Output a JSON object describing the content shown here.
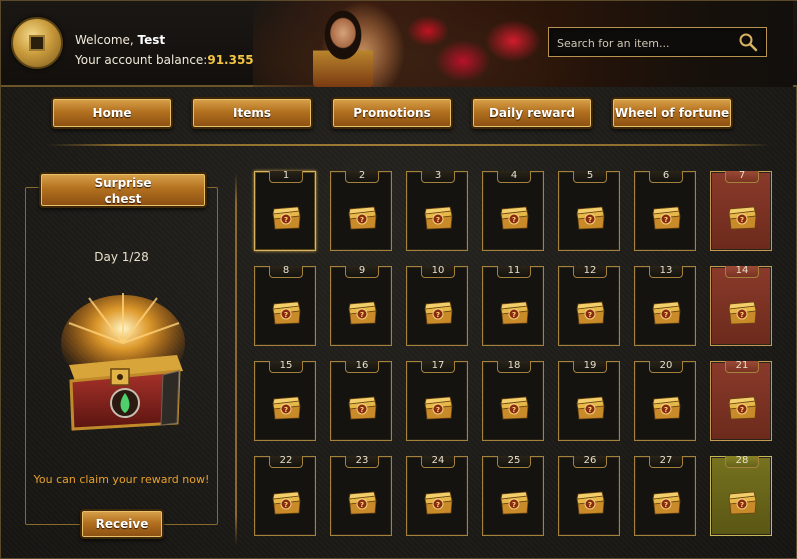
{
  "header": {
    "welcome_prefix": "Welcome, ",
    "username": "Test",
    "balance_label": "Your account balance:",
    "balance_value": "91.355"
  },
  "search": {
    "placeholder": "Search for an item...",
    "icon": "magnifier-icon"
  },
  "nav": {
    "items": [
      {
        "label": "Home"
      },
      {
        "label": "Items"
      },
      {
        "label": "Promotions"
      },
      {
        "label": "Daily reward"
      },
      {
        "label": "Wheel of fortune"
      }
    ]
  },
  "reward_panel": {
    "title_line1": "Surprise",
    "title_line2": "chest",
    "day_label": "Day 1/28",
    "claim_message": "You can claim your reward now!",
    "receive_label": "Receive"
  },
  "calendar": {
    "days": [
      "1",
      "2",
      "3",
      "4",
      "5",
      "6",
      "7",
      "8",
      "9",
      "10",
      "11",
      "12",
      "13",
      "14",
      "15",
      "16",
      "17",
      "18",
      "19",
      "20",
      "21",
      "22",
      "23",
      "24",
      "25",
      "26",
      "27",
      "28"
    ],
    "current_day": "1",
    "weekly_days": [
      "7",
      "14",
      "21"
    ],
    "final_day": "28"
  },
  "colors": {
    "accent_gold": "#f4c542",
    "claim_orange": "#e8a12c",
    "weekly_cell": "#8a3a2a",
    "final_cell": "#76721f"
  }
}
